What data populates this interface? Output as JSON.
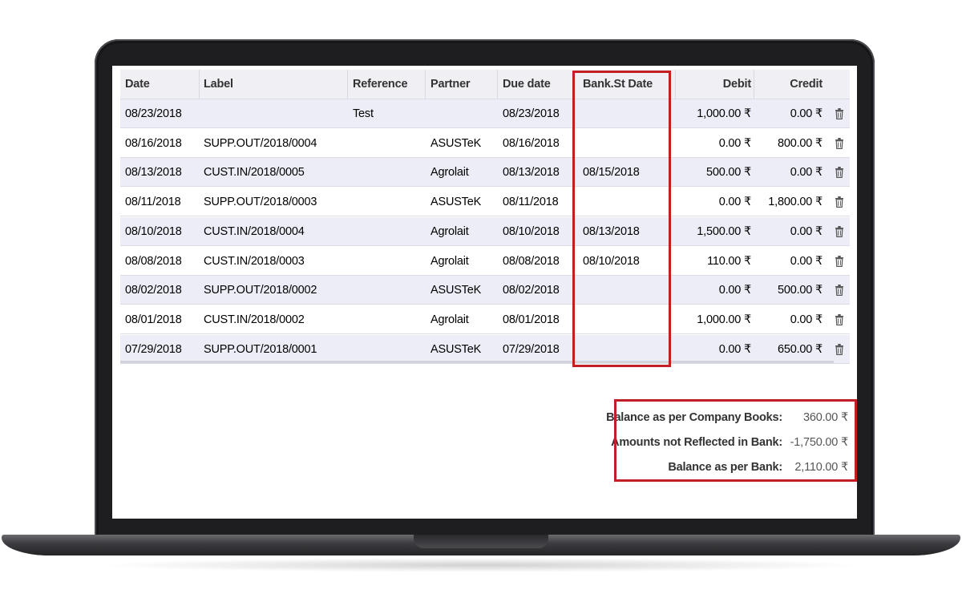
{
  "table": {
    "columns": {
      "date": "Date",
      "label": "Label",
      "reference": "Reference",
      "partner": "Partner",
      "due_date": "Due date",
      "bank_st_date": "Bank.St Date",
      "debit": "Debit",
      "credit": "Credit"
    },
    "rows": [
      {
        "date": "08/23/2018",
        "label": "",
        "reference": "Test",
        "partner": "",
        "due_date": "08/23/2018",
        "bank_st_date": "",
        "debit": "1,000.00 ₹",
        "credit": "0.00 ₹"
      },
      {
        "date": "08/16/2018",
        "label": "SUPP.OUT/2018/0004",
        "reference": "",
        "partner": "ASUSTeK",
        "due_date": "08/16/2018",
        "bank_st_date": "",
        "debit": "0.00 ₹",
        "credit": "800.00 ₹"
      },
      {
        "date": "08/13/2018",
        "label": "CUST.IN/2018/0005",
        "reference": "",
        "partner": "Agrolait",
        "due_date": "08/13/2018",
        "bank_st_date": "08/15/2018",
        "debit": "500.00 ₹",
        "credit": "0.00 ₹"
      },
      {
        "date": "08/11/2018",
        "label": "SUPP.OUT/2018/0003",
        "reference": "",
        "partner": "ASUSTeK",
        "due_date": "08/11/2018",
        "bank_st_date": "",
        "debit": "0.00 ₹",
        "credit": "1,800.00 ₹"
      },
      {
        "date": "08/10/2018",
        "label": "CUST.IN/2018/0004",
        "reference": "",
        "partner": "Agrolait",
        "due_date": "08/10/2018",
        "bank_st_date": "08/13/2018",
        "debit": "1,500.00 ₹",
        "credit": "0.00 ₹"
      },
      {
        "date": "08/08/2018",
        "label": "CUST.IN/2018/0003",
        "reference": "",
        "partner": "Agrolait",
        "due_date": "08/08/2018",
        "bank_st_date": "08/10/2018",
        "debit": "110.00 ₹",
        "credit": "0.00 ₹"
      },
      {
        "date": "08/02/2018",
        "label": "SUPP.OUT/2018/0002",
        "reference": "",
        "partner": "ASUSTeK",
        "due_date": "08/02/2018",
        "bank_st_date": "",
        "debit": "0.00 ₹",
        "credit": "500.00 ₹"
      },
      {
        "date": "08/01/2018",
        "label": "CUST.IN/2018/0002",
        "reference": "",
        "partner": "Agrolait",
        "due_date": "08/01/2018",
        "bank_st_date": "",
        "debit": "1,000.00 ₹",
        "credit": "0.00 ₹"
      },
      {
        "date": "07/29/2018",
        "label": "SUPP.OUT/2018/0001",
        "reference": "",
        "partner": "ASUSTeK",
        "due_date": "07/29/2018",
        "bank_st_date": "",
        "debit": "0.00 ₹",
        "credit": "650.00 ₹"
      }
    ],
    "row_action_icon": "trash-icon"
  },
  "summary": {
    "company_books_label": "Balance as per Company Books:",
    "company_books_value": "360.00 ₹",
    "not_reflected_label": "Amounts not Reflected in Bank:",
    "not_reflected_value": "-1,750.00 ₹",
    "bank_balance_label": "Balance as per Bank:",
    "bank_balance_value": "2,110.00 ₹"
  },
  "colors": {
    "highlight": "#c11f25",
    "row_alt": "#ededf7"
  }
}
